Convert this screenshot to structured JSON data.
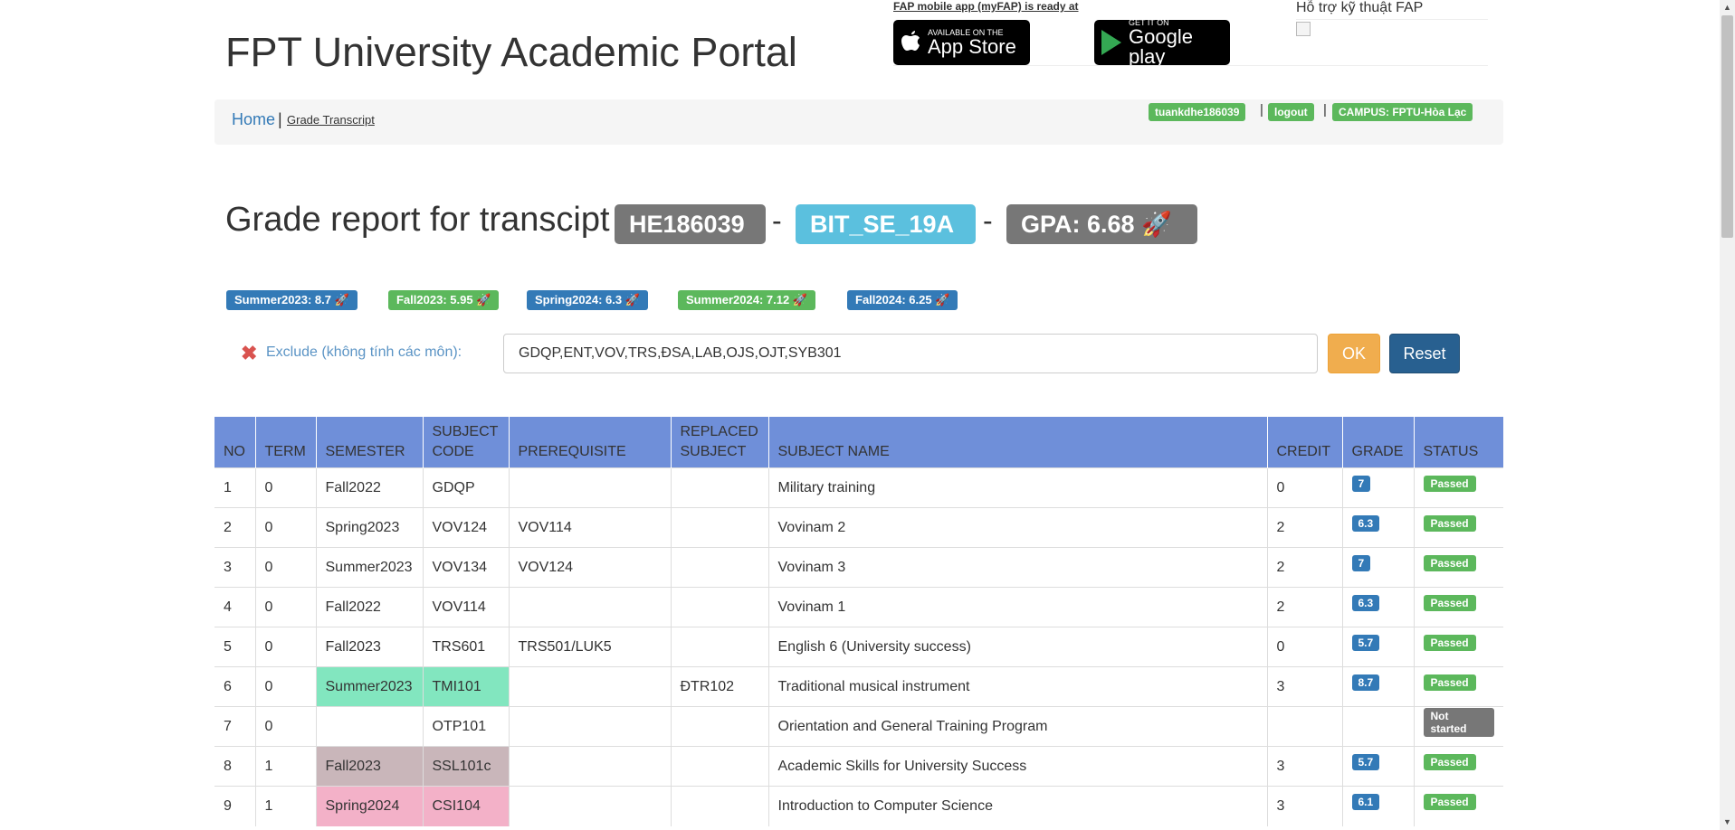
{
  "header": {
    "portal_title": "FPT University Academic Portal",
    "mobile_text": "FAP mobile app (myFAP) is ready at",
    "app_store": {
      "small": "Available on the",
      "big": "App Store"
    },
    "google_play": {
      "small": "GET IT ON",
      "big": "Google play"
    },
    "support_text": "Hỗ trợ kỹ thuật FAP"
  },
  "breadcrumb": {
    "home": "Home",
    "separator": "|",
    "current": "Grade Transcript"
  },
  "user": {
    "username": "tuankdhe186039",
    "logout": "logout",
    "campus": "CAMPUS: FPTU-Hòa Lạc",
    "separator": "|"
  },
  "report": {
    "title": "Grade report for transcipt",
    "student_id": "HE186039",
    "class": "BIT_SE_19A",
    "gpa": "GPA: 6.68 🚀",
    "dash": "-"
  },
  "semesters": [
    {
      "label": "Summer2023: 8.7 🚀",
      "color": "#337ab7"
    },
    {
      "label": "Fall2023: 5.95 🚀",
      "color": "#5cb85c"
    },
    {
      "label": "Spring2024: 6.3 🚀",
      "color": "#337ab7"
    },
    {
      "label": "Summer2024: 7.12 🚀",
      "color": "#5cb85c"
    },
    {
      "label": "Fall2024: 6.25 🚀",
      "color": "#337ab7"
    }
  ],
  "exclude": {
    "icon": "✖",
    "label": "Exclude (không tính các môn):",
    "value": "GDQP,ENT,VOV,TRS,ĐSA,LAB,OJS,OJT,SYB301",
    "ok": "OK",
    "reset": "Reset"
  },
  "table": {
    "headers": [
      "NO",
      "TERM",
      "SEMESTER",
      "SUBJECT CODE",
      "PREREQUISITE",
      "REPLACED SUBJECT",
      "SUBJECT NAME",
      "CREDIT",
      "GRADE",
      "STATUS"
    ],
    "rows": [
      {
        "no": "1",
        "term": "0",
        "semester": "Fall2022",
        "code": "GDQP",
        "prereq": "",
        "replaced": "",
        "name": "Military training",
        "credit": "0",
        "grade": "7",
        "status": "Passed",
        "highlight": ""
      },
      {
        "no": "2",
        "term": "0",
        "semester": "Spring2023",
        "code": "VOV124",
        "prereq": "VOV114",
        "replaced": "",
        "name": "Vovinam 2",
        "credit": "2",
        "grade": "6.3",
        "status": "Passed",
        "highlight": ""
      },
      {
        "no": "3",
        "term": "0",
        "semester": "Summer2023",
        "code": "VOV134",
        "prereq": "VOV124",
        "replaced": "",
        "name": "Vovinam 3",
        "credit": "2",
        "grade": "7",
        "status": "Passed",
        "highlight": ""
      },
      {
        "no": "4",
        "term": "0",
        "semester": "Fall2022",
        "code": "VOV114",
        "prereq": "",
        "replaced": "",
        "name": "Vovinam 1",
        "credit": "2",
        "grade": "6.3",
        "status": "Passed",
        "highlight": ""
      },
      {
        "no": "5",
        "term": "0",
        "semester": "Fall2023",
        "code": "TRS601",
        "prereq": "TRS501/LUK5",
        "replaced": "",
        "name": "English 6 (University success)",
        "credit": "0",
        "grade": "5.7",
        "status": "Passed",
        "highlight": ""
      },
      {
        "no": "6",
        "term": "0",
        "semester": "Summer2023",
        "code": "TMI101",
        "prereq": "",
        "replaced": "ĐTR102",
        "name": "Traditional musical instrument",
        "credit": "3",
        "grade": "8.7",
        "status": "Passed",
        "highlight": "#82e6bf"
      },
      {
        "no": "7",
        "term": "0",
        "semester": "",
        "code": "OTP101",
        "prereq": "",
        "replaced": "",
        "name": "Orientation and General Training Program",
        "credit": "",
        "grade": "",
        "status": "Not started",
        "highlight": ""
      },
      {
        "no": "8",
        "term": "1",
        "semester": "Fall2023",
        "code": "SSL101c",
        "prereq": "",
        "replaced": "",
        "name": "Academic Skills for University Success",
        "credit": "3",
        "grade": "5.7",
        "status": "Passed",
        "highlight": "#c9b6ba"
      },
      {
        "no": "9",
        "term": "1",
        "semester": "Spring2024",
        "code": "CSI104",
        "prereq": "",
        "replaced": "",
        "name": "Introduction to Computer Science",
        "credit": "3",
        "grade": "6.1",
        "status": "Passed",
        "highlight": "#f3b1c8"
      }
    ]
  },
  "colors": {
    "passed": "#5cb85c",
    "not_started": "#777777",
    "header_bg": "#6f8fd9",
    "student_label": "#777777",
    "class_label": "#5bc0de",
    "gpa_label": "#777777",
    "ok_button": "#f0ad4e",
    "reset_button": "#286090"
  }
}
